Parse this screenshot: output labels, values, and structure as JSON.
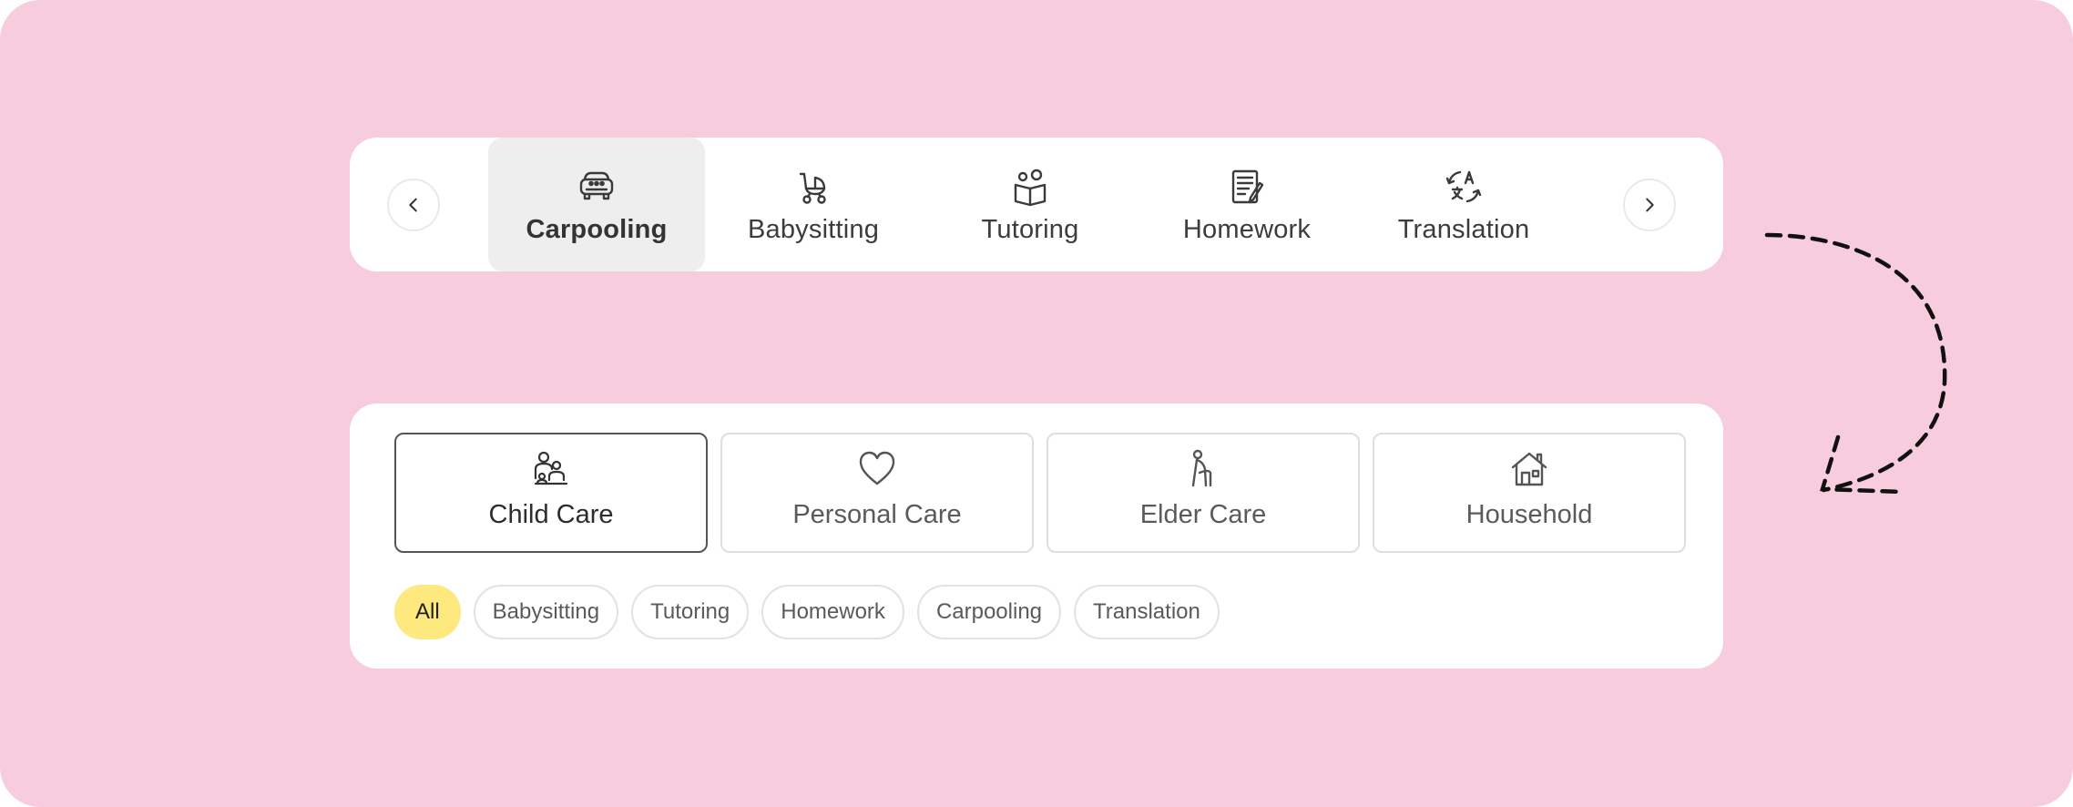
{
  "carousel": {
    "prev_icon": "chevron-left-icon",
    "next_icon": "chevron-right-icon",
    "tabs": [
      {
        "label": "Carpooling",
        "icon": "car-icon",
        "active": true
      },
      {
        "label": "Babysitting",
        "icon": "stroller-icon",
        "active": false
      },
      {
        "label": "Tutoring",
        "icon": "book-reader-icon",
        "active": false
      },
      {
        "label": "Homework",
        "icon": "notebook-pencil-icon",
        "active": false
      },
      {
        "label": "Translation",
        "icon": "translate-icon",
        "active": false
      }
    ]
  },
  "filters": {
    "categories": [
      {
        "label": "Child Care",
        "icon": "family-icon",
        "active": true
      },
      {
        "label": "Personal Care",
        "icon": "heart-icon",
        "active": false
      },
      {
        "label": "Elder Care",
        "icon": "elder-person-icon",
        "active": false
      },
      {
        "label": "Household",
        "icon": "house-icon",
        "active": false
      }
    ],
    "chips": [
      {
        "label": "All",
        "selected": true
      },
      {
        "label": "Babysitting",
        "selected": false
      },
      {
        "label": "Tutoring",
        "selected": false
      },
      {
        "label": "Homework",
        "selected": false
      },
      {
        "label": "Carpooling",
        "selected": false
      },
      {
        "label": "Translation",
        "selected": false
      }
    ]
  },
  "colors": {
    "background": "#f7cddd",
    "card": "#ffffff",
    "active_tab": "#eeeeee",
    "chip_selected": "#fde97d",
    "arrow": "#111111"
  },
  "arrow_icon": "curved-dashed-arrow-icon"
}
